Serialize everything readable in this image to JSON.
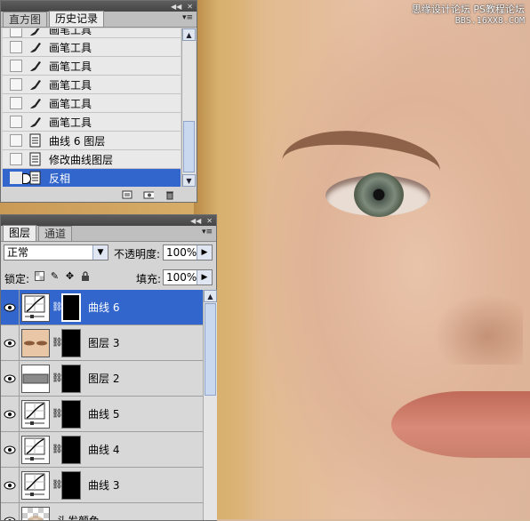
{
  "watermark": {
    "line1": "思缘设计论坛",
    "line2": "PS教程论坛",
    "line3": "BBS.16XX8.COM"
  },
  "history_panel": {
    "tabs": [
      {
        "label": "直方图",
        "active": false
      },
      {
        "label": "历史记录",
        "active": true
      }
    ],
    "items": [
      {
        "label": "画笔工具",
        "icon": "brush-icon",
        "partial": true
      },
      {
        "label": "画笔工具",
        "icon": "brush-icon"
      },
      {
        "label": "画笔工具",
        "icon": "brush-icon"
      },
      {
        "label": "画笔工具",
        "icon": "brush-icon"
      },
      {
        "label": "画笔工具",
        "icon": "brush-icon"
      },
      {
        "label": "画笔工具",
        "icon": "brush-icon"
      },
      {
        "label": "曲线 6 图层",
        "icon": "document-icon"
      },
      {
        "label": "修改曲线图层",
        "icon": "document-icon"
      },
      {
        "label": "反相",
        "icon": "document-icon",
        "selected": true
      }
    ],
    "bottom_icons": [
      "new-document-from-state-icon",
      "new-snapshot-icon",
      "delete-state-icon"
    ]
  },
  "layers_panel": {
    "tabs": [
      {
        "label": "图层",
        "active": true
      },
      {
        "label": "通道",
        "active": false
      }
    ],
    "blend_mode": "正常",
    "opacity_label": "不透明度:",
    "opacity_value": "100%",
    "lock_label": "锁定:",
    "fill_label": "填充:",
    "fill_value": "100%",
    "layers": [
      {
        "name": "曲线 6",
        "thumb": "curves",
        "selected": true
      },
      {
        "name": "图层 3",
        "thumb": "eyes"
      },
      {
        "name": "图层 2",
        "thumb": "gray"
      },
      {
        "name": "曲线 5",
        "thumb": "curves"
      },
      {
        "name": "曲线 4",
        "thumb": "curves"
      },
      {
        "name": "曲线 3",
        "thumb": "curves"
      },
      {
        "name": "头发颜色",
        "thumb": "transparent",
        "partial": true
      }
    ]
  },
  "colors": {
    "selection": "#3366cc",
    "panel_bg": "#d4d4d4"
  }
}
